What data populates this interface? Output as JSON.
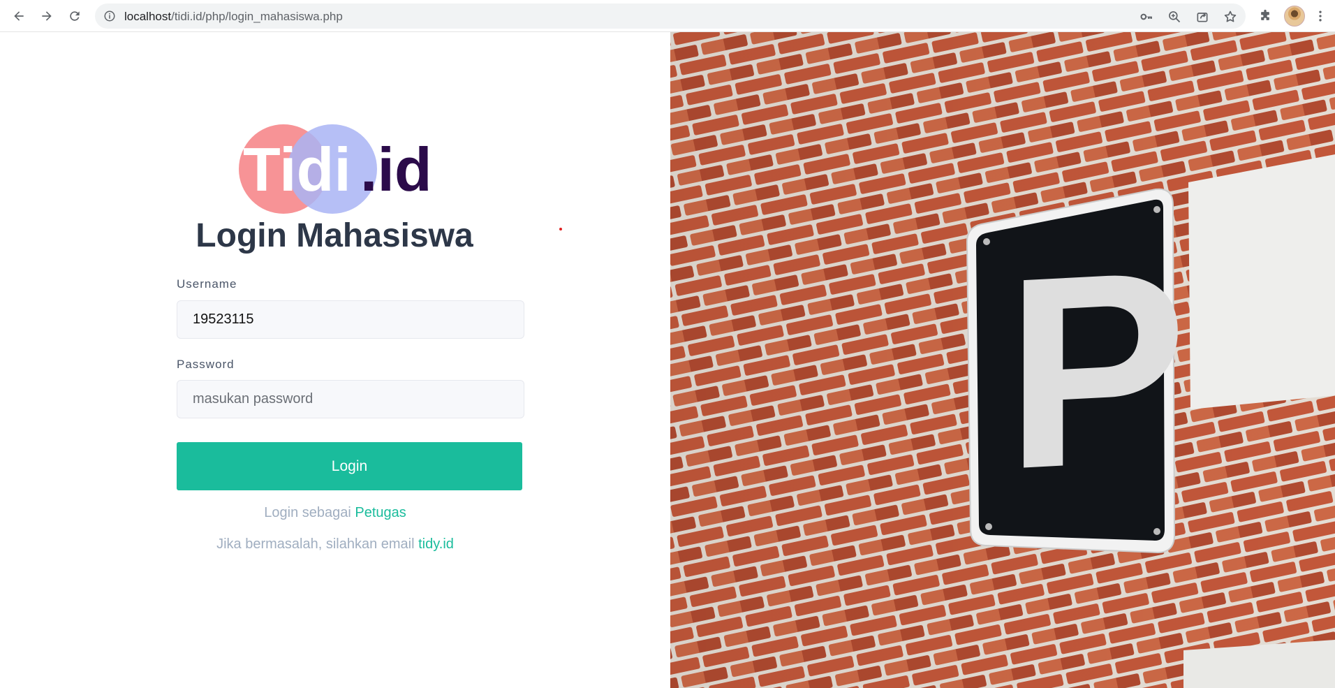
{
  "browser": {
    "url_host": "localhost",
    "url_path": "/tidi.id/php/login_mahasiswa.php"
  },
  "logo": {
    "text_main": "Tidi",
    "text_suffix": ".id",
    "colors": {
      "circle_left": "#f6878b",
      "circle_right": "#a9b4f5",
      "suffix": "#2b0b4a"
    }
  },
  "form": {
    "title": "Login Mahasiswa",
    "username_label": "Username",
    "username_value": "19523115",
    "password_label": "Password",
    "password_placeholder": "masukan password",
    "submit_label": "Login"
  },
  "links": {
    "alt_login_prefix": "Login sebagai ",
    "alt_login_link": "Petugas",
    "help_prefix": "Jika bermasalah, silahkan email ",
    "help_link": "tidy.id"
  },
  "hero": {
    "sign_letter": "P"
  },
  "colors": {
    "accent": "#1abc9c",
    "title": "#2d3748",
    "muted": "#a0aec0"
  }
}
